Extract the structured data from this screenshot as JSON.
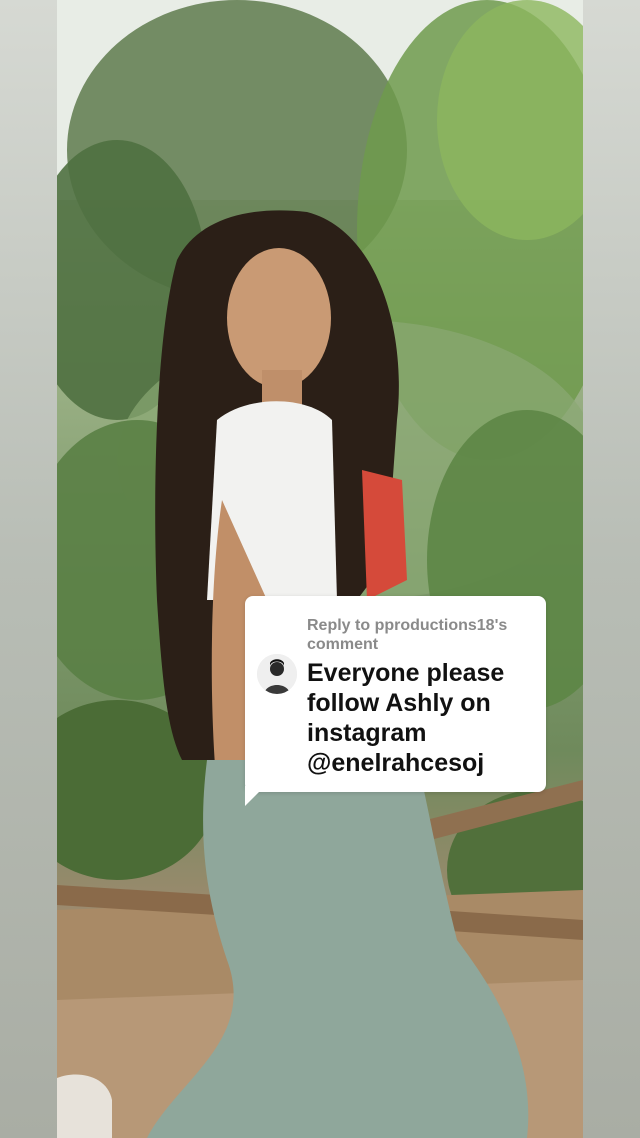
{
  "photo": {
    "description_icon": "photo-of-person-outdoors"
  },
  "reply_card": {
    "reply_label": "Reply to pproductions18's comment",
    "comment_text": "Everyone please follow Ashly on instagram @enelrahcesoj",
    "avatar_icon": "user-avatar-icon"
  },
  "colors": {
    "card_background": "#ffffff",
    "reply_label_color": "#8a8a8a",
    "comment_text_color": "#111111"
  }
}
